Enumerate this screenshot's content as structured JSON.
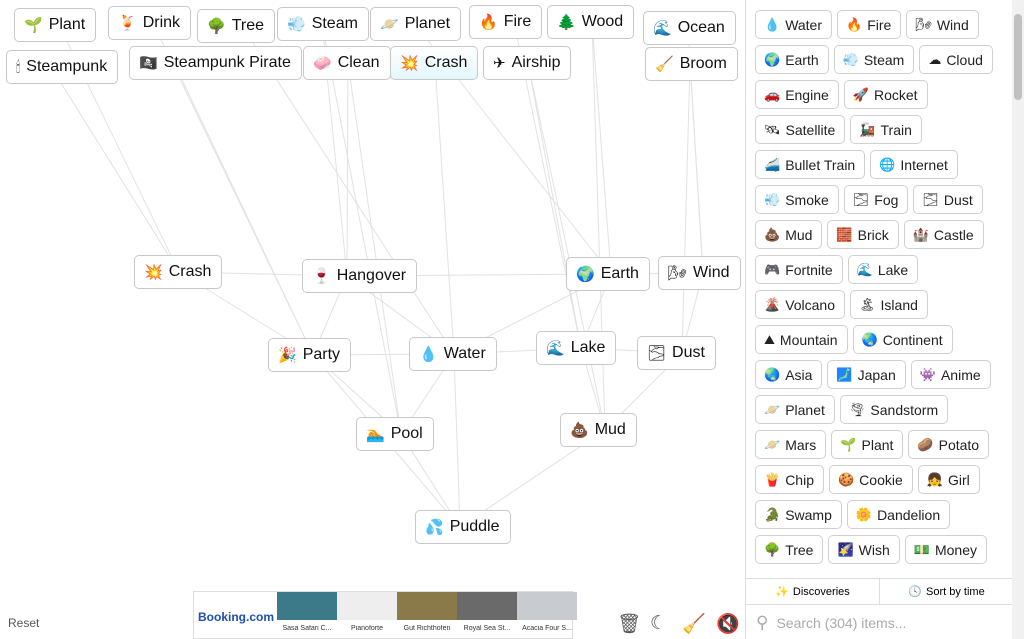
{
  "canvas_items": [
    {
      "label": "Plant",
      "icon": "🌱"
    },
    {
      "label": "Drink",
      "icon": "🍹"
    },
    {
      "label": "Tree",
      "icon": "🌳"
    },
    {
      "label": "Steam",
      "icon": "💨"
    },
    {
      "label": "Planet",
      "icon": "🪐"
    },
    {
      "label": "Fire",
      "icon": "🔥"
    },
    {
      "label": "Wood",
      "icon": "🌲"
    },
    {
      "label": "Ocean",
      "icon": "🌊"
    },
    {
      "label": "Steampunk",
      "icon": "🕯"
    },
    {
      "label": "Steampunk Pirate",
      "icon": "🏴‍☠️"
    },
    {
      "label": "Clean",
      "icon": "🧼"
    },
    {
      "label": "Crash",
      "icon": "💥"
    },
    {
      "label": "Airship",
      "icon": "✈"
    },
    {
      "label": "Broom",
      "icon": "🧹"
    },
    {
      "label": "Crash",
      "icon": "💥"
    },
    {
      "label": "Hangover",
      "icon": "🍷"
    },
    {
      "label": "Earth",
      "icon": "🌍"
    },
    {
      "label": "Wind",
      "icon": "🌬"
    },
    {
      "label": "Party",
      "icon": "🎉"
    },
    {
      "label": "Water",
      "icon": "💧"
    },
    {
      "label": "Lake",
      "icon": "🌊"
    },
    {
      "label": "Dust",
      "icon": "🌫"
    },
    {
      "label": "Pool",
      "icon": "🏊"
    },
    {
      "label": "Mud",
      "icon": "💩"
    },
    {
      "label": "Puddle",
      "icon": "💦"
    }
  ],
  "sidebar": {
    "items": [
      {
        "label": "Water",
        "icon": "💧"
      },
      {
        "label": "Fire",
        "icon": "🔥"
      },
      {
        "label": "Wind",
        "icon": "🌬"
      },
      {
        "label": "Earth",
        "icon": "🌍"
      },
      {
        "label": "Steam",
        "icon": "💨"
      },
      {
        "label": "Cloud",
        "icon": "☁"
      },
      {
        "label": "Engine",
        "icon": "🚗"
      },
      {
        "label": "Rocket",
        "icon": "🚀"
      },
      {
        "label": "Satellite",
        "icon": "🛰"
      },
      {
        "label": "Train",
        "icon": "🚂"
      },
      {
        "label": "Bullet Train",
        "icon": "🚄"
      },
      {
        "label": "Internet",
        "icon": "🌐"
      },
      {
        "label": "Smoke",
        "icon": "💨"
      },
      {
        "label": "Fog",
        "icon": "🌫"
      },
      {
        "label": "Dust",
        "icon": "🌫"
      },
      {
        "label": "Mud",
        "icon": "💩"
      },
      {
        "label": "Brick",
        "icon": "🧱"
      },
      {
        "label": "Castle",
        "icon": "🏰"
      },
      {
        "label": "Fortnite",
        "icon": "🎮"
      },
      {
        "label": "Lake",
        "icon": "🌊"
      },
      {
        "label": "Volcano",
        "icon": "🌋"
      },
      {
        "label": "Island",
        "icon": "🏝"
      },
      {
        "label": "Mountain",
        "icon": "⛰"
      },
      {
        "label": "Continent",
        "icon": "🌏"
      },
      {
        "label": "Asia",
        "icon": "🌏"
      },
      {
        "label": "Japan",
        "icon": "🗾"
      },
      {
        "label": "Anime",
        "icon": "👾"
      },
      {
        "label": "Planet",
        "icon": "🪐"
      },
      {
        "label": "Sandstorm",
        "icon": "🌪"
      },
      {
        "label": "Mars",
        "icon": "🪐"
      },
      {
        "label": "Plant",
        "icon": "🌱"
      },
      {
        "label": "Potato",
        "icon": "🥔"
      },
      {
        "label": "Chip",
        "icon": "🍟"
      },
      {
        "label": "Cookie",
        "icon": "🍪"
      },
      {
        "label": "Girl",
        "icon": "👧"
      },
      {
        "label": "Swamp",
        "icon": "🐊"
      },
      {
        "label": "Dandelion",
        "icon": "🌼"
      },
      {
        "label": "Tree",
        "icon": "🌳"
      },
      {
        "label": "Wish",
        "icon": "🌠"
      },
      {
        "label": "Money",
        "icon": "💵"
      }
    ],
    "tabs": {
      "discoveries": "Discoveries",
      "sort": "Sort by time"
    },
    "search_placeholder": "Search (304) items..."
  },
  "footer": {
    "reset": "Reset"
  },
  "ad": {
    "brand": "Booking.com",
    "captions": [
      "Sasa Safari C...",
      "Pianoforte",
      "Gut Richthofen",
      "Royal Sea St...",
      "Acacia Four S..."
    ]
  }
}
